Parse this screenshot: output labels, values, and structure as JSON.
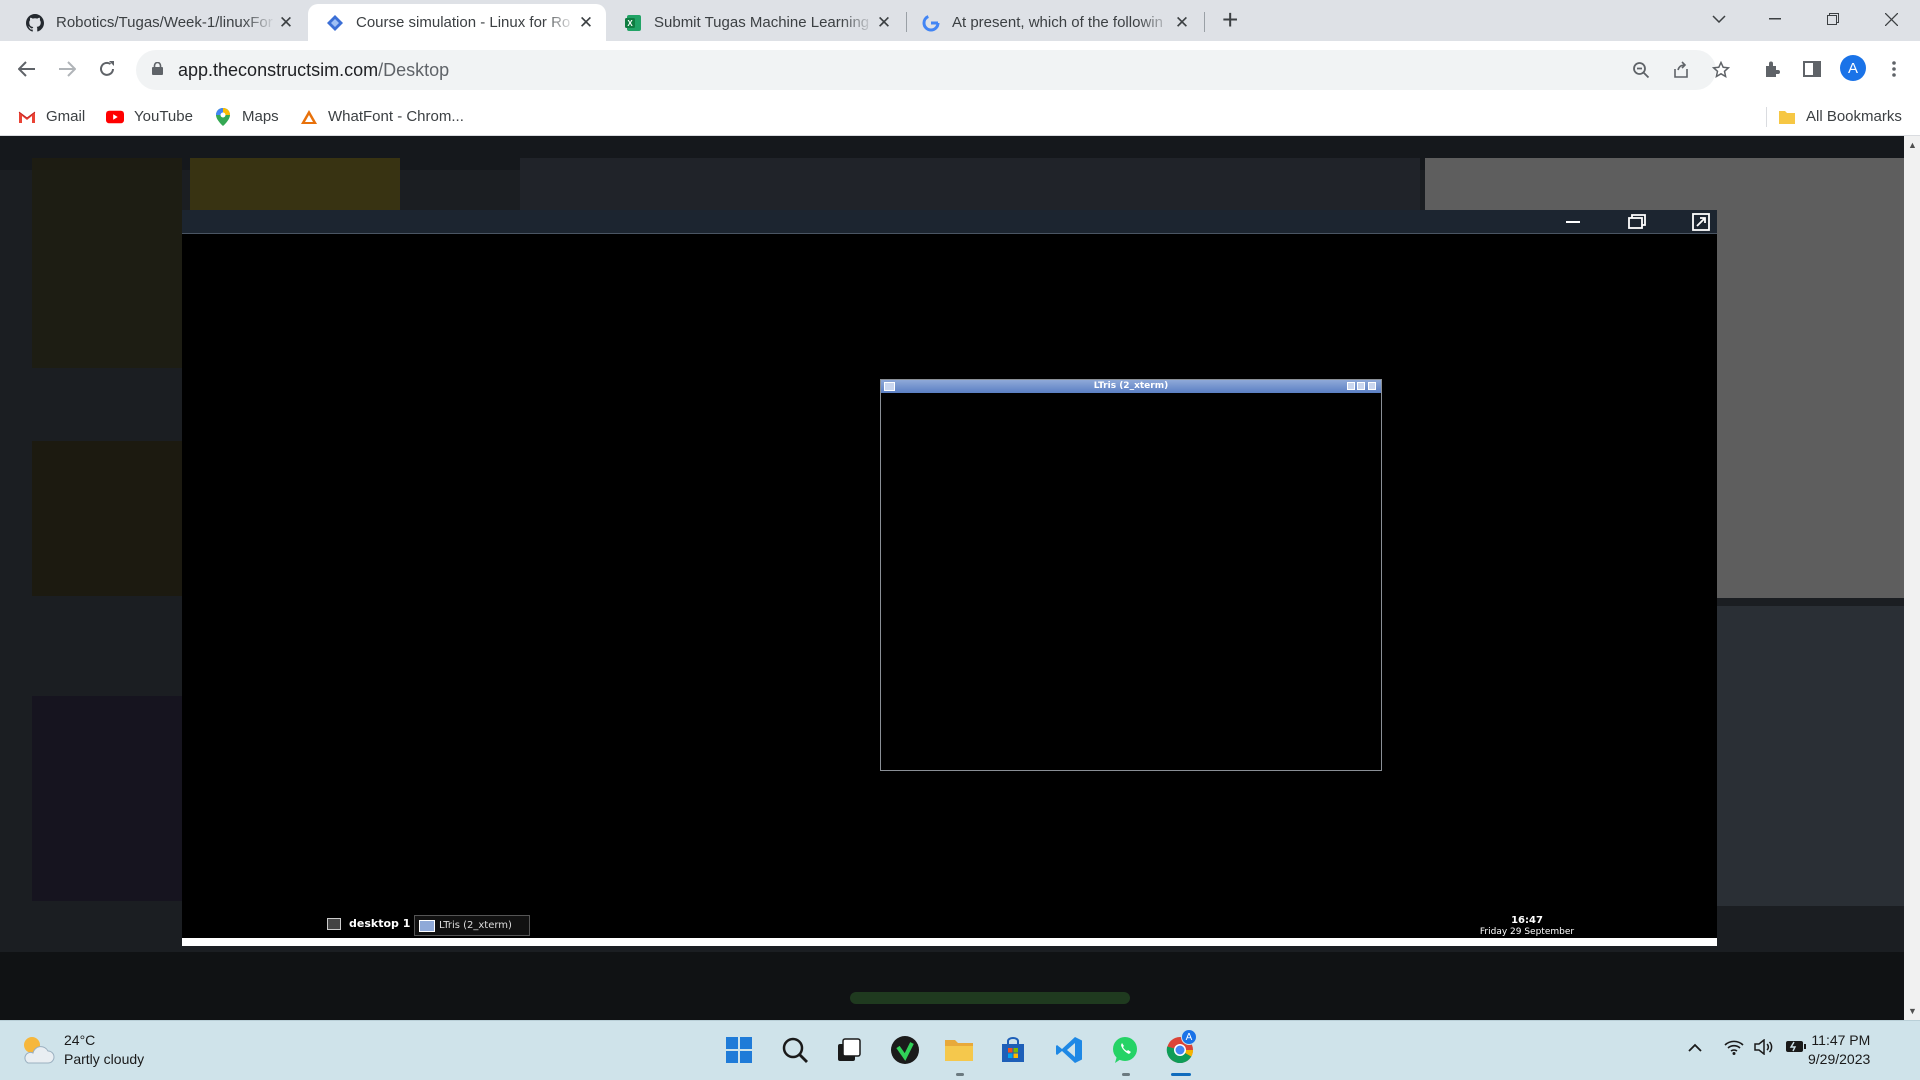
{
  "tabs": [
    {
      "title": "Robotics/Tugas/Week-1/linuxFor",
      "icon": "github-icon",
      "active": false
    },
    {
      "title": "Course simulation - Linux for Ro",
      "icon": "constructsim-icon",
      "active": true
    },
    {
      "title": "Submit Tugas Machine Learning",
      "icon": "excel-icon",
      "active": false
    },
    {
      "title": "At present, which of the followin",
      "icon": "google-icon",
      "active": false
    }
  ],
  "toolbar": {
    "url_host": "app.theconstructsim.com",
    "url_path": "/Desktop",
    "avatar_letter": "A"
  },
  "bookmarks": [
    {
      "label": "Gmail",
      "icon": "gmail-icon"
    },
    {
      "label": "YouTube",
      "icon": "youtube-icon"
    },
    {
      "label": "Maps",
      "icon": "maps-icon"
    },
    {
      "label": "WhatFont - Chrom...",
      "icon": "whatfont-icon"
    }
  ],
  "bookmarks_right": {
    "label": "All Bookmarks",
    "icon": "folder-icon"
  },
  "vnc": {
    "xterm_title": "LTris (2_xterm)",
    "workspace_label": "desktop 1",
    "task_label": "LTris (2_xterm)",
    "clock_time": "16:47",
    "clock_date": "Friday 29 September"
  },
  "taskbar": {
    "weather_temp": "24°C",
    "weather_desc": "Partly cloudy",
    "time": "11:47 PM",
    "date": "9/29/2023",
    "chrome_badge": "A"
  },
  "colors": {
    "accent": "#1a73e8",
    "vnc_titlebar": "#1c2530",
    "xterm_titlebar": "#6f8fcf",
    "taskbar": "#cfe3ea"
  }
}
